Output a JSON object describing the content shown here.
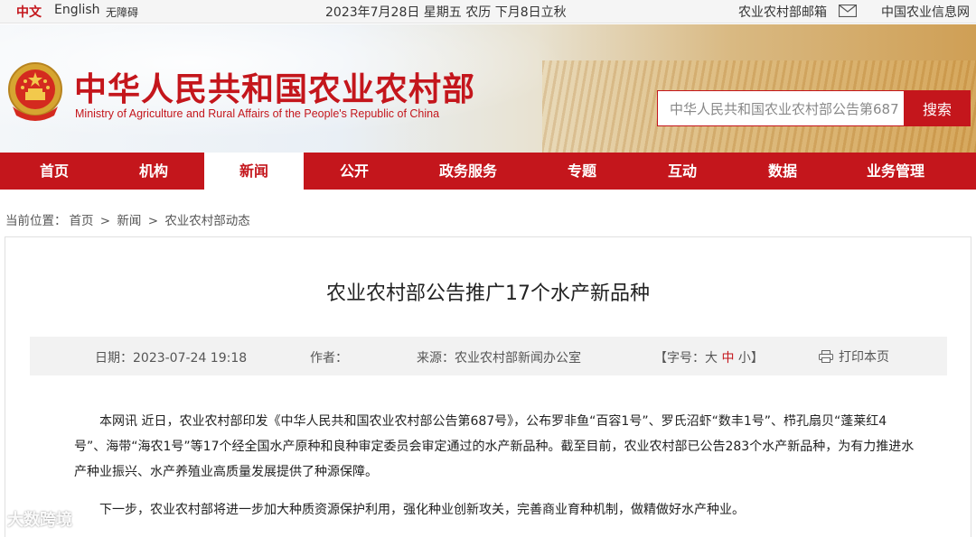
{
  "topbar": {
    "lang_cn": "中文",
    "lang_en": "English",
    "accessibility": "无障碍",
    "date": "2023年7月28日 星期五 农历 下月8日立秋",
    "mail": "农业农村部邮箱",
    "info_net": "中国农业信息网"
  },
  "header": {
    "title": "中华人民共和国农业农村部",
    "subtitle": "Ministry of Agriculture and Rural Affairs of the People's Republic of China",
    "search_value": "中华人民共和国农业农村部公告第687",
    "search_button": "搜索"
  },
  "nav": {
    "items": [
      "首页",
      "机构",
      "新闻",
      "公开",
      "政务服务",
      "专题",
      "互动",
      "数据",
      "业务管理"
    ],
    "active": "新闻"
  },
  "breadcrumb": {
    "prefix": "当前位置：",
    "items": [
      "首页",
      ">",
      "新闻",
      ">",
      "农业农村部动态"
    ]
  },
  "article": {
    "title": "农业农村部公告推广17个水产新品种",
    "date_label": "日期：",
    "date": "2023-07-24 19:18",
    "author_label": "作者：",
    "source_label": "来源：",
    "source": "农业农村部新闻办公室",
    "font_label_open": "【字号：",
    "font_large": "大",
    "font_medium": "中",
    "font_small": "小",
    "font_label_close": "】",
    "print": "打印本页",
    "paragraphs": [
      "本网讯 近日，农业农村部印发《中华人民共和国农业农村部公告第687号》，公布罗非鱼“百容1号”、罗氏沼虾“数丰1号”、栉孔扇贝“蓬莱红4号”、海带“海农1号”等17个经全国水产原种和良种审定委员会审定通过的水产新品种。截至目前，农业农村部已公告283个水产新品种，为有力推进水产种业振兴、水产养殖业高质量发展提供了种源保障。",
      "下一步，农业农村部将进一步加大种质资源保护利用，强化种业创新攻关，完善商业育种机制，做精做好水产种业。"
    ]
  },
  "watermark": "大数跨境",
  "colors": {
    "brand_red": "#c4161c",
    "meta_bg": "#f2f2f2"
  }
}
